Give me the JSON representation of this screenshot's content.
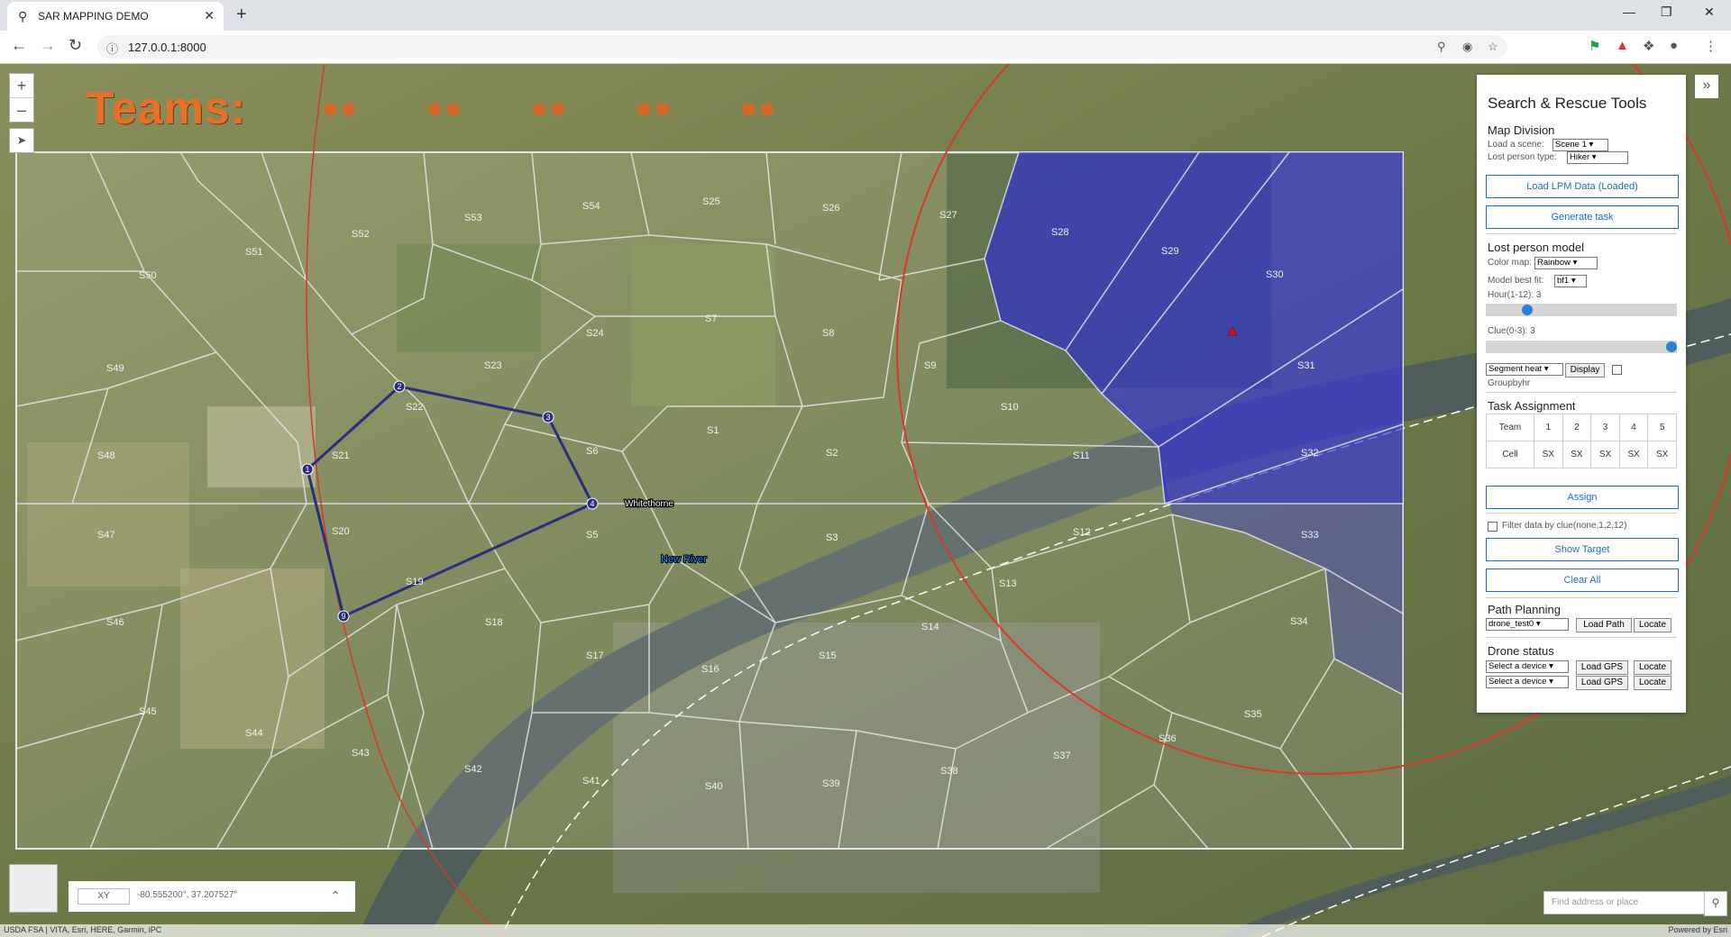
{
  "browser": {
    "tab_title": "SAR MAPPING DEMO",
    "url": "127.0.0.1:8000"
  },
  "map": {
    "teams_title": "Teams:",
    "team_icons": [
      "team-icon-1",
      "team-icon-2",
      "team-icon-3",
      "team-icon-4",
      "team-icon-5"
    ],
    "cells": [
      "S1",
      "S2",
      "S3",
      "S5",
      "S6",
      "S7",
      "S8",
      "S9",
      "S10",
      "S11",
      "S12",
      "S13",
      "S14",
      "S15",
      "S16",
      "S17",
      "S18",
      "S19",
      "S20",
      "S21",
      "S22",
      "S23",
      "S24",
      "S25",
      "S26",
      "S27",
      "S28",
      "S29",
      "S30",
      "S31",
      "S32",
      "S33",
      "S34",
      "S35",
      "S36",
      "S37",
      "S38",
      "S39",
      "S40",
      "S41",
      "S42",
      "S43",
      "S44",
      "S45",
      "S46",
      "S47",
      "S48",
      "S49",
      "S50",
      "S51",
      "S52",
      "S53",
      "S54"
    ],
    "path_points": [
      "1",
      "2",
      "3",
      "4",
      "9"
    ],
    "place_labels": {
      "whitethorne": "Whitethorne",
      "river": "New River"
    },
    "accent_blue": "#3b3bd6",
    "circle_color": "#d33a2a"
  },
  "panel": {
    "title": "Search & Rescue Tools",
    "map_division": {
      "heading": "Map Division",
      "load_scene_label": "Load a scene:",
      "scene_value": "Scene 1",
      "lost_person_type_label": "Lost person type:",
      "lost_person_type_value": "Hiker",
      "load_lpm_button": "Load LPM Data (Loaded)",
      "generate_task_button": "Generate task"
    },
    "lost_person_model": {
      "heading": "Lost person model",
      "color_map_label": "Color map:",
      "color_map_value": "Rainbow",
      "best_fit_label": "Model best fit:",
      "best_fit_value": "bf1",
      "hour_label": "Hour(1-12): 3",
      "hour_fraction": 0.2,
      "clue_label": "Clue(0-3): 3",
      "clue_fraction": 1.0,
      "heat_select": "Segment heat",
      "display_button": "Display",
      "groupbyhr_label": "Groupbyhr"
    },
    "task_assignment": {
      "heading": "Task Assignment",
      "header": [
        "Team",
        "1",
        "2",
        "3",
        "4",
        "5"
      ],
      "row": [
        "Cell",
        "SX",
        "SX",
        "SX",
        "SX",
        "SX"
      ],
      "assign_button": "Assign",
      "filter_label": "Filter data by clue(none,1,2,12)",
      "show_target_button": "Show Target",
      "clear_all_button": "Clear All"
    },
    "path_planning": {
      "heading": "Path Planning",
      "path_select": "drone_test0",
      "load_path_button": "Load Path",
      "locate_button": "Locate"
    },
    "drone_status": {
      "heading": "Drone status",
      "rows": [
        {
          "device": "Select a device",
          "load": "Load GPS",
          "locate": "Locate"
        },
        {
          "device": "Select a device",
          "load": "Load GPS",
          "locate": "Locate"
        }
      ]
    }
  },
  "bottom": {
    "xy_label": "XY",
    "coordinates": "-80.555200°, 37.207527°",
    "search_placeholder": "Find address or place",
    "attribution_left": "USDA FSA | VITA, Esri, HERE, Garmin, iPC",
    "attribution_right": "Powered by Esri"
  }
}
